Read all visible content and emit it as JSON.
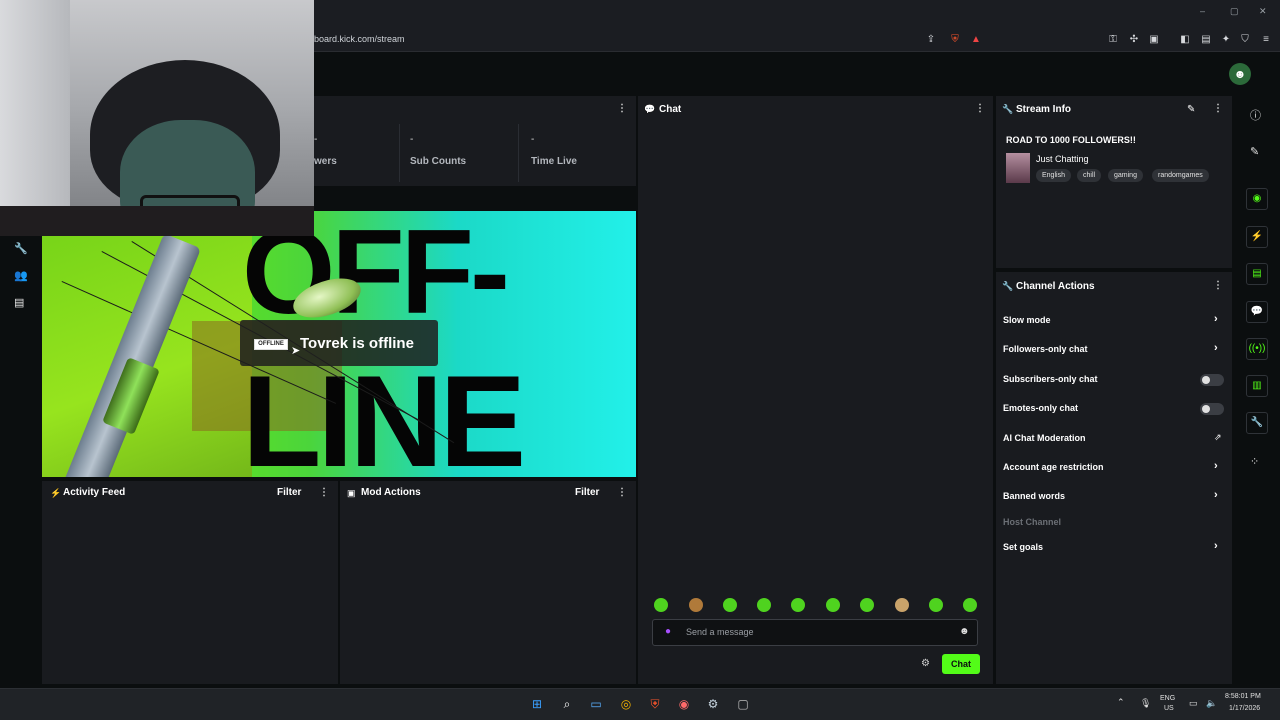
{
  "browser": {
    "url": "board.kick.com/stream",
    "window_controls": [
      "–",
      "▢",
      "✕"
    ]
  },
  "stats": [
    {
      "value": "-",
      "label": "wers"
    },
    {
      "value": "-",
      "label": "Sub Counts"
    },
    {
      "value": "-",
      "label": "Time Live"
    }
  ],
  "offline": {
    "badge": "OFFLINE",
    "message": "Tovrek is offline",
    "banner_top": "OFF-",
    "banner_bottom": "LINE"
  },
  "panels": {
    "activity_feed": {
      "title": "Activity Feed",
      "filter": "Filter"
    },
    "mod_actions": {
      "title": "Mod Actions",
      "filter": "Filter"
    },
    "chat": {
      "title": "Chat",
      "placeholder": "Send a message",
      "send_label": "Chat"
    },
    "stream_info": {
      "title": "Stream Info",
      "stream_title": "ROAD TO 1000 FOLLOWERS!!",
      "category": "Just Chatting",
      "tags": [
        "English",
        "chill",
        "gaming",
        "randomgames"
      ]
    },
    "channel_actions": {
      "title": "Channel Actions",
      "items": [
        {
          "label": "Slow mode",
          "control": "chevron"
        },
        {
          "label": "Followers-only chat",
          "control": "chevron"
        },
        {
          "label": "Subscribers-only chat",
          "control": "toggle",
          "on": false
        },
        {
          "label": "Emotes-only chat",
          "control": "toggle",
          "on": false
        },
        {
          "label": "AI Chat Moderation",
          "control": "external"
        },
        {
          "label": "Account age restriction",
          "control": "chevron"
        },
        {
          "label": "Banned words",
          "control": "chevron"
        },
        {
          "label": "Host Channel",
          "control": "disabled"
        },
        {
          "label": "Set goals",
          "control": "chevron"
        }
      ]
    }
  },
  "taskbar": {
    "lang_top": "ENG",
    "lang_bottom": "US",
    "time": "8:58:01 PM",
    "date": "1/17/2026"
  },
  "colors": {
    "accent": "#53fc18",
    "panel": "#191b1f",
    "background": "#0b0e0f"
  }
}
